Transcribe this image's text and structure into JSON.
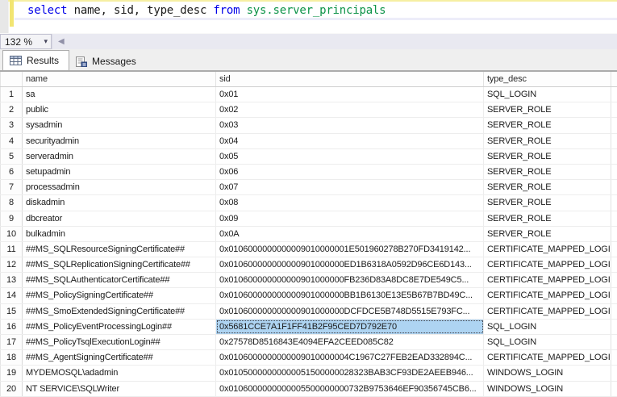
{
  "editor": {
    "query_tokens": [
      {
        "text": "select ",
        "type": "keyword"
      },
      {
        "text": "name, sid, type_desc ",
        "type": "identifier"
      },
      {
        "text": "from ",
        "type": "keyword"
      },
      {
        "text": "sys.server_principals",
        "type": "system-object"
      }
    ]
  },
  "zoom_bar": {
    "zoom_level": "132 %",
    "dropdown_icon": "▾",
    "scroll_left_icon": "◀"
  },
  "tabs": [
    {
      "label": "Results",
      "icon": "results-grid-icon",
      "active": true
    },
    {
      "label": "Messages",
      "icon": "messages-icon",
      "active": false
    }
  ],
  "grid": {
    "columns": {
      "name": "name",
      "sid": "sid",
      "type_desc": "type_desc"
    },
    "selection": {
      "row": 16,
      "column": "sid"
    },
    "rows": [
      {
        "num": "1",
        "name": "sa",
        "sid": "0x01",
        "type_desc": "SQL_LOGIN"
      },
      {
        "num": "2",
        "name": "public",
        "sid": "0x02",
        "type_desc": "SERVER_ROLE"
      },
      {
        "num": "3",
        "name": "sysadmin",
        "sid": "0x03",
        "type_desc": "SERVER_ROLE"
      },
      {
        "num": "4",
        "name": "securityadmin",
        "sid": "0x04",
        "type_desc": "SERVER_ROLE"
      },
      {
        "num": "5",
        "name": "serveradmin",
        "sid": "0x05",
        "type_desc": "SERVER_ROLE"
      },
      {
        "num": "6",
        "name": "setupadmin",
        "sid": "0x06",
        "type_desc": "SERVER_ROLE"
      },
      {
        "num": "7",
        "name": "processadmin",
        "sid": "0x07",
        "type_desc": "SERVER_ROLE"
      },
      {
        "num": "8",
        "name": "diskadmin",
        "sid": "0x08",
        "type_desc": "SERVER_ROLE"
      },
      {
        "num": "9",
        "name": "dbcreator",
        "sid": "0x09",
        "type_desc": "SERVER_ROLE"
      },
      {
        "num": "10",
        "name": "bulkadmin",
        "sid": "0x0A",
        "type_desc": "SERVER_ROLE"
      },
      {
        "num": "11",
        "name": "##MS_SQLResourceSigningCertificate##",
        "sid": "0x0106000000000009010000001E501960278B270FD3419142...",
        "type_desc": "CERTIFICATE_MAPPED_LOGIN"
      },
      {
        "num": "12",
        "name": "##MS_SQLReplicationSigningCertificate##",
        "sid": "0x010600000000000901000000ED1B6318A0592D96CE6D143...",
        "type_desc": "CERTIFICATE_MAPPED_LOGIN"
      },
      {
        "num": "13",
        "name": "##MS_SQLAuthenticatorCertificate##",
        "sid": "0x010600000000000901000000FB236D83A8DC8E7DE549C5...",
        "type_desc": "CERTIFICATE_MAPPED_LOGIN"
      },
      {
        "num": "14",
        "name": "##MS_PolicySigningCertificate##",
        "sid": "0x010600000000000901000000BB1B6130E13E5B67B7BD49C...",
        "type_desc": "CERTIFICATE_MAPPED_LOGIN"
      },
      {
        "num": "15",
        "name": "##MS_SmoExtendedSigningCertificate##",
        "sid": "0x010600000000000901000000DCFDCE5B748D5515E793FC...",
        "type_desc": "CERTIFICATE_MAPPED_LOGIN"
      },
      {
        "num": "16",
        "name": "##MS_PolicyEventProcessingLogin##",
        "sid": "0x5681CCE7A1F1FF41B2F95CED7D792E70",
        "type_desc": "SQL_LOGIN"
      },
      {
        "num": "17",
        "name": "##MS_PolicyTsqlExecutionLogin##",
        "sid": "0x27578D8516843E4094EFA2CEED085C82",
        "type_desc": "SQL_LOGIN"
      },
      {
        "num": "18",
        "name": "##MS_AgentSigningCertificate##",
        "sid": "0x0106000000000009010000004C1967C27FEB2EAD332894C...",
        "type_desc": "CERTIFICATE_MAPPED_LOGIN"
      },
      {
        "num": "19",
        "name": "MYDEMOSQL\\adadmin",
        "sid": "0x01050000000000051500000028323BAB3CF93DE2AEEB946...",
        "type_desc": "WINDOWS_LOGIN"
      },
      {
        "num": "20",
        "name": "NT SERVICE\\SQLWriter",
        "sid": "0x0106000000000005500000000732B9753646EF90356745CB6...",
        "type_desc": "WINDOWS_LOGIN"
      }
    ]
  },
  "colors": {
    "keyword_blue": "#0000E8",
    "system_object_green": "#0D9348",
    "change_bar_yellow": "#F2E572",
    "selection_blue": "#AED4F2",
    "grid_line": "#EDEDED"
  }
}
